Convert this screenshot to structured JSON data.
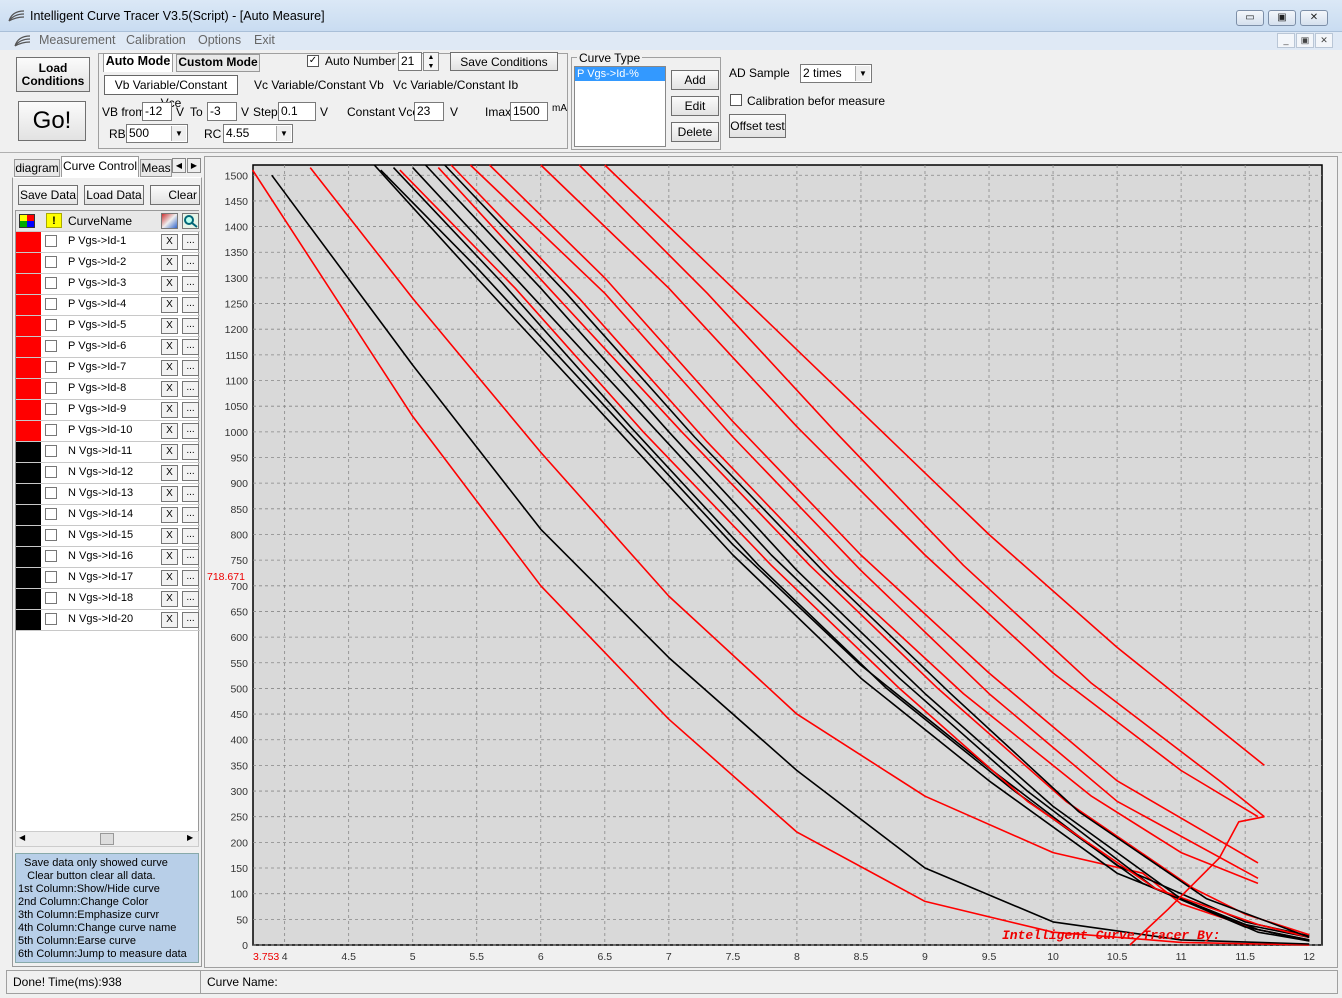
{
  "window": {
    "title": "Intelligent Curve Tracer V3.5(Script) - [Auto Measure]",
    "min_glyph": "▭",
    "max_glyph": "▣",
    "close_glyph": "✕"
  },
  "menu": [
    "Measurement",
    "Calibration",
    "Options",
    "Exit"
  ],
  "toolbar": {
    "load_conditions": "Load Conditions",
    "go": "Go!",
    "auto_mode_tab": "Auto Mode",
    "custom_mode_tab": "Custom Mode",
    "auto_number_label": "Auto Number",
    "auto_number_checked": "✓",
    "auto_number_value": "21",
    "save_conditions": "Save Conditions",
    "subtabs": [
      "Vb Variable/Constant Vce",
      "Vc Variable/Constant Vb",
      "Vc Variable/Constant Ib"
    ],
    "vb_from_label": "VB from",
    "vb_from_value": "-12",
    "v1": "V",
    "to_label": "To",
    "to_value": "-3",
    "v2": "V",
    "step_label": "Step",
    "step_value": "0.1",
    "v3": "V",
    "constant_vce_label": "Constant Vce",
    "constant_vce_value": "23",
    "v4": "V",
    "imax_label": "Imax",
    "imax_value": "1500",
    "ma": "mA",
    "rb_label": "RB",
    "rb_value": "500",
    "rc_label": "RC",
    "rc_value": "4.55"
  },
  "curve_type": {
    "label": "Curve Type",
    "selected_item": "P Vgs->Id-%",
    "add": "Add",
    "edit": "Edit",
    "delete": "Delete"
  },
  "ad_sample": {
    "label": "AD Sample",
    "value": "2 times",
    "calibration_label": "Calibration befor measure",
    "offset_test": "Offset test"
  },
  "left_tabs": [
    "diagram",
    "Curve Control",
    "Meas"
  ],
  "left_buttons": {
    "save_data": "Save Data",
    "load_data": "Load Data",
    "clear": "Clear"
  },
  "grid_header": {
    "name": "CurveName",
    "warning_glyph": "!"
  },
  "curves": [
    {
      "name": "P Vgs->Id-1",
      "color": "#ff0000"
    },
    {
      "name": "P Vgs->Id-2",
      "color": "#ff0000"
    },
    {
      "name": "P Vgs->Id-3",
      "color": "#ff0000"
    },
    {
      "name": "P Vgs->Id-4",
      "color": "#ff0000"
    },
    {
      "name": "P Vgs->Id-5",
      "color": "#ff0000"
    },
    {
      "name": "P Vgs->Id-6",
      "color": "#ff0000"
    },
    {
      "name": "P Vgs->Id-7",
      "color": "#ff0000"
    },
    {
      "name": "P Vgs->Id-8",
      "color": "#ff0000"
    },
    {
      "name": "P Vgs->Id-9",
      "color": "#ff0000"
    },
    {
      "name": "P Vgs->Id-10",
      "color": "#ff0000"
    },
    {
      "name": "N Vgs->Id-11",
      "color": "#000000"
    },
    {
      "name": "N Vgs->Id-12",
      "color": "#000000"
    },
    {
      "name": "N Vgs->Id-13",
      "color": "#000000"
    },
    {
      "name": "N Vgs->Id-14",
      "color": "#000000"
    },
    {
      "name": "N Vgs->Id-15",
      "color": "#000000"
    },
    {
      "name": "N Vgs->Id-16",
      "color": "#000000"
    },
    {
      "name": "N Vgs->Id-17",
      "color": "#000000"
    },
    {
      "name": "N Vgs->Id-18",
      "color": "#000000"
    },
    {
      "name": "N Vgs->Id-20",
      "color": "#000000"
    }
  ],
  "row_buttons": {
    "x": "X",
    "dots": "..."
  },
  "help_text": [
    "  Save data only showed curve",
    "   Clear button clear all data.",
    "1st Column:Show/Hide curve",
    "2nd Column:Change Color",
    "3th Column:Emphasize curvr",
    "4th Column:Change curve name",
    "5th Column:Earse curve",
    "6th Column:Jump to measure data"
  ],
  "status": {
    "left": "Done!  Time(ms):938",
    "right": "Curve Name:"
  },
  "chart_data": {
    "type": "line",
    "title": "",
    "xlabel": "",
    "ylabel": "",
    "xlim": [
      3.753,
      12.1
    ],
    "ylim": [
      0,
      1520
    ],
    "grid": true,
    "x_ticks": [
      4,
      4.5,
      5,
      5.5,
      6,
      6.5,
      7,
      7.5,
      8,
      8.5,
      9,
      9.5,
      10,
      10.5,
      11,
      11.5,
      12
    ],
    "x_tick_labels": [
      "4",
      "4.5",
      "5",
      "5.5",
      "6",
      "6.5",
      "7",
      "7.5",
      "8",
      "8.5",
      "9",
      "9.5",
      "10",
      "10.5",
      "11",
      "11.5",
      "12"
    ],
    "y_ticks": [
      0,
      50,
      100,
      150,
      200,
      250,
      300,
      350,
      400,
      450,
      500,
      550,
      600,
      650,
      700,
      750,
      800,
      850,
      900,
      950,
      1000,
      1050,
      1100,
      1150,
      1200,
      1250,
      1300,
      1350,
      1400,
      1450,
      1500
    ],
    "y_tick_labels": [
      "0",
      "50",
      "100",
      "150",
      "200",
      "250",
      "300",
      "350",
      "400",
      "450",
      "500",
      "550",
      "600",
      "650",
      "700",
      "750",
      "800",
      "850",
      "900",
      "950",
      "1000",
      "1050",
      "1100",
      "1150",
      "1200",
      "1250",
      "1300",
      "1350",
      "1400",
      "1450",
      "1500"
    ],
    "cursor_y_label": "718.671",
    "cursor_x_label": "3.753",
    "watermark": "Intelligent Curve Tracer By:",
    "series": [
      {
        "color": "#ff0000",
        "points": [
          [
            3.75,
            1510
          ],
          [
            5.0,
            1030
          ],
          [
            6.0,
            700
          ],
          [
            7.0,
            440
          ],
          [
            8.0,
            220
          ],
          [
            9.0,
            85
          ],
          [
            10.0,
            25
          ],
          [
            11.0,
            5
          ],
          [
            12.0,
            0
          ]
        ]
      },
      {
        "color": "#000000",
        "points": [
          [
            3.9,
            1500
          ],
          [
            5.0,
            1130
          ],
          [
            6.0,
            810
          ],
          [
            7.0,
            560
          ],
          [
            8.0,
            340
          ],
          [
            9.0,
            150
          ],
          [
            10.0,
            45
          ],
          [
            11.0,
            10
          ],
          [
            12.0,
            2
          ]
        ]
      },
      {
        "color": "#ff0000",
        "points": [
          [
            4.2,
            1515
          ],
          [
            5.0,
            1260
          ],
          [
            6.0,
            960
          ],
          [
            7.0,
            680
          ],
          [
            8.0,
            450
          ],
          [
            9.0,
            290
          ],
          [
            10.0,
            180
          ],
          [
            10.7,
            140
          ],
          [
            11.0,
            80
          ],
          [
            11.6,
            30
          ],
          [
            12.0,
            10
          ]
        ]
      },
      {
        "color": "#000000",
        "points": [
          [
            4.7,
            1520
          ],
          [
            5.5,
            1300
          ],
          [
            6.5,
            1030
          ],
          [
            7.5,
            760
          ],
          [
            8.5,
            520
          ],
          [
            9.5,
            320
          ],
          [
            10.5,
            140
          ],
          [
            11.5,
            40
          ],
          [
            12.0,
            15
          ]
        ]
      },
      {
        "color": "#000000",
        "points": [
          [
            4.75,
            1510
          ],
          [
            5.5,
            1320
          ],
          [
            6.5,
            1050
          ],
          [
            7.5,
            780
          ],
          [
            8.5,
            545
          ],
          [
            9.5,
            345
          ],
          [
            10.5,
            155
          ],
          [
            11.5,
            45
          ],
          [
            12.0,
            18
          ]
        ]
      },
      {
        "color": "#000000",
        "points": [
          [
            4.85,
            1515
          ],
          [
            5.7,
            1290
          ],
          [
            6.7,
            1010
          ],
          [
            7.7,
            740
          ],
          [
            8.7,
            500
          ],
          [
            9.7,
            300
          ],
          [
            10.7,
            120
          ],
          [
            11.5,
            35
          ],
          [
            12.0,
            10
          ]
        ]
      },
      {
        "color": "#000000",
        "points": [
          [
            5.0,
            1515
          ],
          [
            5.8,
            1300
          ],
          [
            6.8,
            1030
          ],
          [
            7.8,
            760
          ],
          [
            8.8,
            520
          ],
          [
            9.8,
            300
          ],
          [
            10.8,
            110
          ],
          [
            11.6,
            30
          ],
          [
            12.0,
            8
          ]
        ]
      },
      {
        "color": "#ff0000",
        "points": [
          [
            4.9,
            1510
          ],
          [
            5.8,
            1280
          ],
          [
            6.8,
            1000
          ],
          [
            7.8,
            740
          ],
          [
            8.8,
            500
          ],
          [
            9.8,
            280
          ],
          [
            10.8,
            110
          ],
          [
            11.6,
            40
          ],
          [
            12.0,
            15
          ]
        ]
      },
      {
        "color": "#000000",
        "points": [
          [
            5.1,
            1520
          ],
          [
            6.0,
            1280
          ],
          [
            7.0,
            1000
          ],
          [
            8.0,
            730
          ],
          [
            9.0,
            490
          ],
          [
            10.0,
            270
          ],
          [
            11.0,
            90
          ],
          [
            11.6,
            25
          ],
          [
            12.0,
            8
          ]
        ]
      },
      {
        "color": "#ff0000",
        "points": [
          [
            5.2,
            1515
          ],
          [
            6.1,
            1270
          ],
          [
            7.1,
            1000
          ],
          [
            8.1,
            740
          ],
          [
            9.1,
            500
          ],
          [
            10.1,
            280
          ],
          [
            11.1,
            110
          ],
          [
            11.5,
            60
          ],
          [
            12.0,
            20
          ]
        ]
      },
      {
        "color": "#000000",
        "points": [
          [
            5.25,
            1520
          ],
          [
            6.2,
            1270
          ],
          [
            7.2,
            990
          ],
          [
            8.2,
            730
          ],
          [
            9.2,
            490
          ],
          [
            10.2,
            260
          ],
          [
            11.2,
            90
          ],
          [
            12.0,
            15
          ]
        ]
      },
      {
        "color": "#ff0000",
        "points": [
          [
            5.3,
            1520
          ],
          [
            6.3,
            1260
          ],
          [
            7.3,
            980
          ],
          [
            8.3,
            720
          ],
          [
            9.3,
            490
          ],
          [
            10.3,
            290
          ],
          [
            11.0,
            180
          ],
          [
            11.6,
            120
          ]
        ]
      },
      {
        "color": "#ff0000",
        "points": [
          [
            5.45,
            1520
          ],
          [
            6.5,
            1270
          ],
          [
            7.5,
            990
          ],
          [
            8.5,
            730
          ],
          [
            9.5,
            490
          ],
          [
            10.5,
            280
          ],
          [
            11.6,
            130
          ]
        ]
      },
      {
        "color": "#ff0000",
        "points": [
          [
            5.6,
            1520
          ],
          [
            6.5,
            1300
          ],
          [
            7.5,
            1020
          ],
          [
            8.5,
            760
          ],
          [
            9.5,
            530
          ],
          [
            10.5,
            320
          ],
          [
            11.6,
            160
          ]
        ]
      },
      {
        "color": "#ff0000",
        "points": [
          [
            6.0,
            1520
          ],
          [
            7.0,
            1280
          ],
          [
            8.0,
            1010
          ],
          [
            9.0,
            760
          ],
          [
            10.0,
            530
          ],
          [
            11.0,
            340
          ],
          [
            11.6,
            250
          ]
        ]
      },
      {
        "color": "#ff0000",
        "points": [
          [
            6.3,
            1520
          ],
          [
            7.3,
            1270
          ],
          [
            8.3,
            1000
          ],
          [
            9.3,
            740
          ],
          [
            10.3,
            510
          ],
          [
            11.3,
            320
          ],
          [
            11.65,
            250
          ]
        ]
      },
      {
        "color": "#ff0000",
        "points": [
          [
            6.5,
            1520
          ],
          [
            7.5,
            1280
          ],
          [
            8.5,
            1040
          ],
          [
            9.5,
            800
          ],
          [
            10.5,
            580
          ],
          [
            11.65,
            350
          ]
        ]
      },
      {
        "color": "#ff0000",
        "points": [
          [
            10.6,
            0
          ],
          [
            10.9,
            70
          ],
          [
            11.1,
            120
          ],
          [
            11.3,
            170
          ],
          [
            11.45,
            240
          ],
          [
            11.65,
            250
          ]
        ]
      }
    ]
  }
}
